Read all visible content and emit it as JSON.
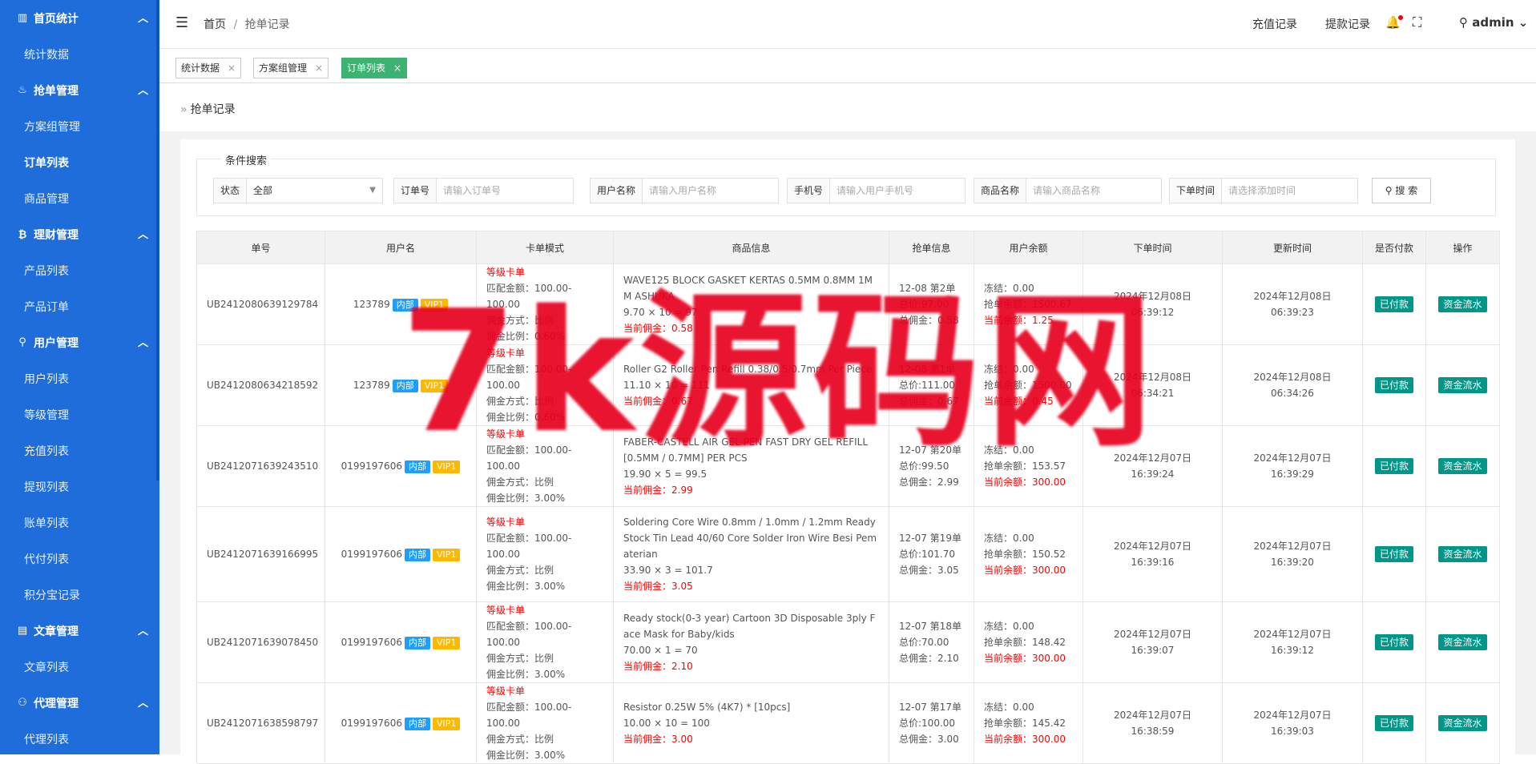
{
  "sidebar": {
    "groups": [
      {
        "label": "首页统计",
        "icon": "bar-chart-icon",
        "items": [
          "统计数据"
        ]
      },
      {
        "label": "抢单管理",
        "icon": "fire-icon",
        "items": [
          "方案组管理",
          "订单列表",
          "商品管理"
        ]
      },
      {
        "label": "理财管理",
        "icon": "bitcoin-icon",
        "items": [
          "产品列表",
          "产品订单"
        ]
      },
      {
        "label": "用户管理",
        "icon": "user-icon",
        "items": [
          "用户列表",
          "等级管理",
          "充值列表",
          "提现列表",
          "账单列表",
          "代付列表",
          "积分宝记录"
        ]
      },
      {
        "label": "文章管理",
        "icon": "document-icon",
        "items": [
          "文章列表"
        ]
      },
      {
        "label": "代理管理",
        "icon": "agent-icon",
        "items": [
          "代理列表"
        ]
      }
    ],
    "active_item": "订单列表",
    "colors": {
      "bg": "#1f6ddb"
    }
  },
  "header": {
    "breadcrumb_home": "首页",
    "breadcrumb_sep": "/",
    "breadcrumb_current": "抢单记录",
    "recharge_link": "充值记录",
    "withdraw_link": "提款记录",
    "username": "admin"
  },
  "tabs": [
    {
      "label": "统计数据",
      "active": false
    },
    {
      "label": "方案组管理",
      "active": false
    },
    {
      "label": "订单列表",
      "active": true
    }
  ],
  "page": {
    "title": "抢单记录",
    "search": {
      "legend": "条件搜索",
      "status_label": "状态",
      "status_value": "全部",
      "order_label": "订单号",
      "order_placeholder": "请输入订单号",
      "username_label": "用户名称",
      "username_placeholder": "请输入用户名称",
      "phone_label": "手机号",
      "phone_placeholder": "请输入用户手机号",
      "goods_label": "商品名称",
      "goods_placeholder": "请输入商品名称",
      "time_label": "下单时间",
      "time_placeholder": "请选择添加时间",
      "button": "搜 索"
    }
  },
  "table": {
    "columns": [
      "单号",
      "用户名",
      "卡单模式",
      "商品信息",
      "抢单信息",
      "用户余额",
      "下单时间",
      "更新时间",
      "是否付款",
      "操作"
    ],
    "rows": [
      {
        "order_no": "UB2412080639129784",
        "user": "123789",
        "tag1": "内部",
        "tag2": "VIP1",
        "mode": [
          "等级卡单",
          "匹配金额：100.00-100.00",
          "佣金方式：比例",
          "佣金比例：0.60%"
        ],
        "goods_name": "WAVE125 BLOCK GASKET KERTAS 0.5MM 0.8MM 1MM ASHUKA",
        "goods_calc": "9.70 × 10 = 97",
        "goods_comm": "当前佣金：0.58",
        "grab": [
          "12-08 第2单",
          "总价:97.00",
          "总佣金：0.58"
        ],
        "bal_frozen": "冻结：0.00",
        "bal_grab": "抢单余额：1500.67",
        "bal_cur": "当前余额：1.25",
        "created": "2024年12月08日 06:39:12",
        "updated": "2024年12月08日 06:39:23",
        "paid": "已付款",
        "action": "资金流水"
      },
      {
        "order_no": "UB2412080634218592",
        "user": "123789",
        "tag1": "内部",
        "tag2": "VIP1",
        "mode": [
          "等级卡单",
          "匹配金额：100.00-100.00",
          "佣金方式：比例",
          "佣金比例：0.60%"
        ],
        "goods_name": "Roller G2 Roller Pen Refill 0.38/0.5/0.7mm Per Piece",
        "goods_calc": "11.10 × 10 = 111",
        "goods_comm": "当前佣金：0.67",
        "grab": [
          "12-08 第1单",
          "总价:111.00",
          "总佣金：0.67"
        ],
        "bal_frozen": "冻结：0.00",
        "bal_grab": "抢单余额：1500.00",
        "bal_cur": "当前余额：0.45",
        "created": "2024年12月08日 06:34:21",
        "updated": "2024年12月08日 06:34:26",
        "paid": "已付款",
        "action": "资金流水"
      },
      {
        "order_no": "UB2412071639243510",
        "user": "0199197606",
        "tag1": "内部",
        "tag2": "VIP1",
        "mode": [
          "等级卡单",
          "匹配金额：100.00-100.00",
          "佣金方式：比例",
          "佣金比例：3.00%"
        ],
        "goods_name": "FABER-CASTELL AIR GEL PEN FAST DRY GEL REFILL [0.5MM / 0.7MM] PER PCS",
        "goods_calc": "19.90 × 5 = 99.5",
        "goods_comm": "当前佣金：2.99",
        "grab": [
          "12-07 第20单",
          "总价:99.50",
          "总佣金：2.99"
        ],
        "bal_frozen": "冻结：0.00",
        "bal_grab": "抢单余额：153.57",
        "bal_cur": "当前余额：300.00",
        "created": "2024年12月07日 16:39:24",
        "updated": "2024年12月07日 16:39:29",
        "paid": "已付款",
        "action": "资金流水"
      },
      {
        "order_no": "UB2412071639166995",
        "user": "0199197606",
        "tag1": "内部",
        "tag2": "VIP1",
        "mode": [
          "等级卡单",
          "匹配金额：100.00-100.00",
          "佣金方式：比例",
          "佣金比例：3.00%"
        ],
        "goods_name": "Soldering Core Wire 0.8mm / 1.0mm / 1.2mm Ready Stock Tin Lead 40/60 Core Solder Iron Wire Besi Pematerian",
        "goods_calc": "33.90 × 3 = 101.7",
        "goods_comm": "当前佣金：3.05",
        "grab": [
          "12-07 第19单",
          "总价:101.70",
          "总佣金：3.05"
        ],
        "bal_frozen": "冻结：0.00",
        "bal_grab": "抢单余额：150.52",
        "bal_cur": "当前余额：300.00",
        "created": "2024年12月07日 16:39:16",
        "updated": "2024年12月07日 16:39:20",
        "paid": "已付款",
        "action": "资金流水"
      },
      {
        "order_no": "UB2412071639078450",
        "user": "0199197606",
        "tag1": "内部",
        "tag2": "VIP1",
        "mode": [
          "等级卡单",
          "匹配金额：100.00-100.00",
          "佣金方式：比例",
          "佣金比例：3.00%"
        ],
        "goods_name": "Ready stock(0-3 year) Cartoon 3D Disposable 3ply Face Mask for Baby/kids",
        "goods_calc": "70.00 × 1 = 70",
        "goods_comm": "当前佣金：2.10",
        "grab": [
          "12-07 第18单",
          "总价:70.00",
          "总佣金：2.10"
        ],
        "bal_frozen": "冻结：0.00",
        "bal_grab": "抢单余额：148.42",
        "bal_cur": "当前余额：300.00",
        "created": "2024年12月07日 16:39:07",
        "updated": "2024年12月07日 16:39:12",
        "paid": "已付款",
        "action": "资金流水"
      },
      {
        "order_no": "UB2412071638598797",
        "user": "0199197606",
        "tag1": "内部",
        "tag2": "VIP1",
        "mode": [
          "等级卡单",
          "匹配金额：100.00-100.00",
          "佣金方式：比例",
          "佣金比例：3.00%"
        ],
        "goods_name": "Resistor 0.25W 5% (4K7) * [10pcs]",
        "goods_calc": "10.00 × 10 = 100",
        "goods_comm": "当前佣金：3.00",
        "grab": [
          "12-07 第17单",
          "总价:100.00",
          "总佣金：3.00"
        ],
        "bal_frozen": "冻结：0.00",
        "bal_grab": "抢单余额：145.42",
        "bal_cur": "当前余额：300.00",
        "created": "2024年12月07日 16:38:59",
        "updated": "2024年12月07日 16:39:03",
        "paid": "已付款",
        "action": "资金流水"
      }
    ]
  },
  "watermark": "7k源码网",
  "colors": {
    "accent": "#1f6ddb",
    "tab_active": "#3cb371",
    "paid_btn": "#009688",
    "vip": "#ffb800",
    "inner": "#1e9fff",
    "highlight": "#ff0000"
  }
}
